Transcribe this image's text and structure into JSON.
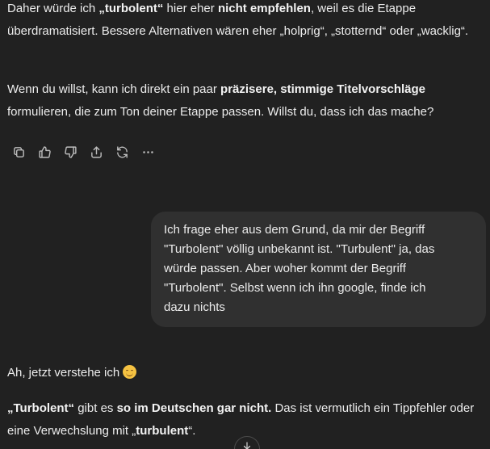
{
  "assistant_message_1": {
    "p1_a": "Daher würde ich ",
    "p1_b": "„turbolent“",
    "p1_c": " hier eher ",
    "p1_d": "nicht empfehlen",
    "p1_e": ", weil es die Etappe überdramatisiert. Bessere Alternativen wären eher „holprig“, „stotternd“ oder „wacklig“.",
    "p2_a": "Wenn du willst, kann ich direkt ein paar ",
    "p2_b": "präzisere, stimmige Titelvorschläge",
    "p2_c": " formulieren, die zum Ton deiner Etappe passen. Willst du, dass ich das mache?"
  },
  "action_bar": {
    "icons": [
      "copy-icon",
      "thumbs-up-icon",
      "thumbs-down-icon",
      "share-icon",
      "regenerate-icon",
      "more-icon"
    ]
  },
  "user_message": {
    "text": "Ich frage eher aus dem Grund, da mir der Begriff\n\"Turbolent\" völlig unbekannt ist. \"Turbulent\" ja, das\nwürde passen. Aber woher kommt der Begriff\n\"Turbolent\". Selbst wenn ich ihn google, finde ich\ndazu nichts"
  },
  "assistant_message_2": {
    "p3": "Ah, jetzt verstehe ich",
    "p3_emoji": "smiling-face-emoji",
    "p4_a": "„Turbolent“",
    "p4_b": " gibt es ",
    "p4_c": "so im Deutschen gar nicht.",
    "p4_d": " Das ist vermutlich ein Tippfehler oder eine Verwechslung mit „",
    "p4_e": "turbulent",
    "p4_f": "“."
  },
  "scroll_button": {
    "icon": "arrow-down-icon"
  }
}
